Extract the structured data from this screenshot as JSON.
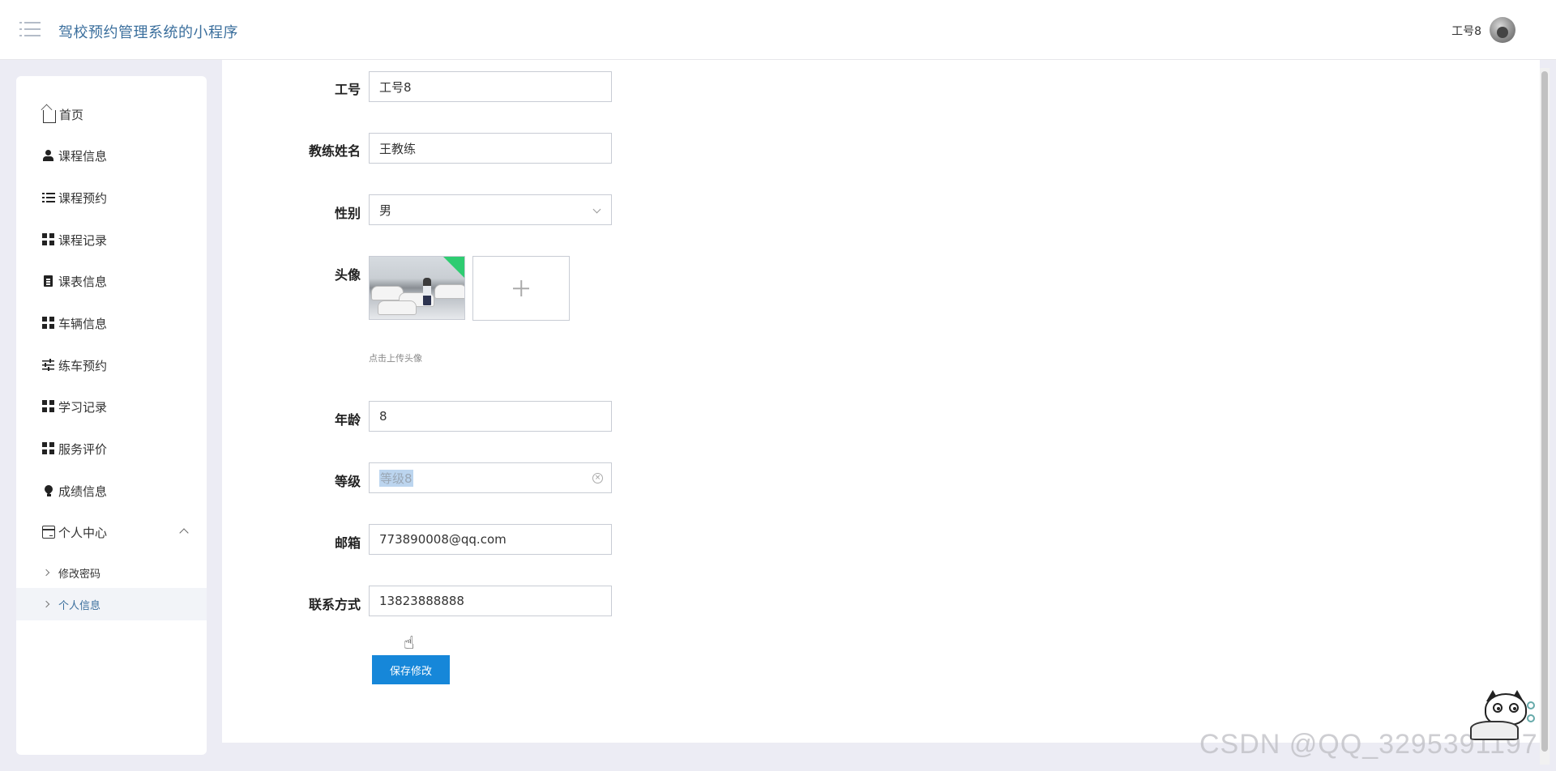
{
  "header": {
    "app_title": "驾校预约管理系统的小程序",
    "user_name": "工号8"
  },
  "sidebar": {
    "items": [
      {
        "label": "首页",
        "icon": "home-icon"
      },
      {
        "label": "课程信息",
        "icon": "user-icon"
      },
      {
        "label": "课程预约",
        "icon": "list-icon"
      },
      {
        "label": "课程记录",
        "icon": "grid-icon"
      },
      {
        "label": "课表信息",
        "icon": "clipboard-icon"
      },
      {
        "label": "车辆信息",
        "icon": "grid-icon"
      },
      {
        "label": "练车预约",
        "icon": "sliders-icon"
      },
      {
        "label": "学习记录",
        "icon": "grid-icon"
      },
      {
        "label": "服务评价",
        "icon": "grid-icon"
      },
      {
        "label": "成绩信息",
        "icon": "bulb-icon"
      },
      {
        "label": "个人中心",
        "icon": "card-icon",
        "expanded": true
      }
    ],
    "sub_items": [
      {
        "label": "修改密码",
        "active": false
      },
      {
        "label": "个人信息",
        "active": true
      }
    ]
  },
  "form": {
    "job_no": {
      "label": "工号",
      "value": "工号8"
    },
    "coach_name": {
      "label": "教练姓名",
      "value": "王教练"
    },
    "gender": {
      "label": "性别",
      "value": "男"
    },
    "avatar": {
      "label": "头像",
      "hint": "点击上传头像"
    },
    "age": {
      "label": "年龄",
      "value": "8"
    },
    "level": {
      "label": "等级",
      "value": "等级8"
    },
    "email": {
      "label": "邮箱",
      "value": "773890008@qq.com"
    },
    "contact": {
      "label": "联系方式",
      "value": "13823888888"
    },
    "save_label": "保存修改"
  },
  "watermark": "CSDN @QQ_3295391197",
  "colors": {
    "accent": "#1687d9",
    "title": "#3b6f9d",
    "background": "#ececf4",
    "upload_badge": "#2ecc71"
  }
}
